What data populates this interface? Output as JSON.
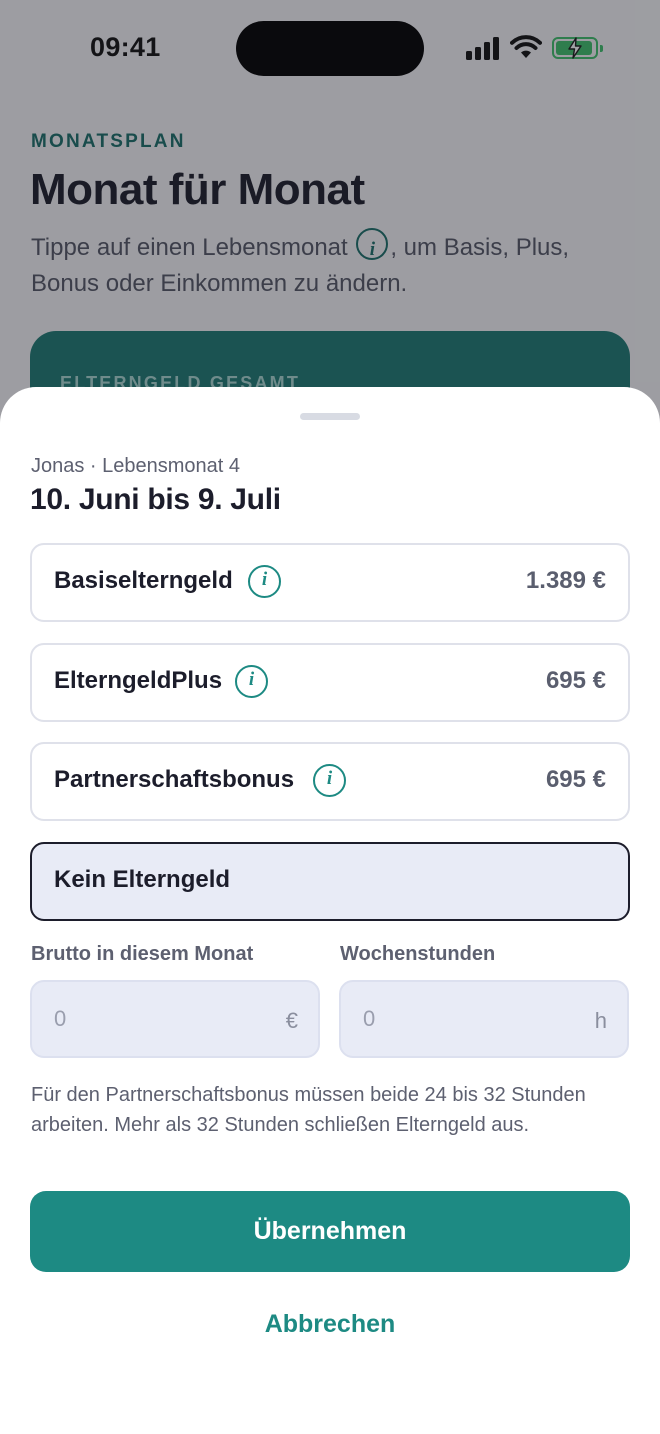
{
  "status_bar": {
    "time": "09:41"
  },
  "background_page": {
    "kicker": "MONATSPLAN",
    "title": "Monat für Monat",
    "subtitle_before_icon": "Tippe auf einen Lebensmonat ",
    "subtitle_after_icon": ", um Basis, Plus, Bonus oder Einkommen zu ändern.",
    "summary_card_label": "ELTERNGELD GESAMT"
  },
  "sheet": {
    "kicker": "Jonas · Lebensmonat 4",
    "title": "10. Juni bis 9. Juli",
    "options": [
      {
        "label": "Basiselterngeld",
        "amount": "1.389 €",
        "icon": "info-icon",
        "selected": false
      },
      {
        "label": "ElterngeldPlus",
        "amount": "695 €",
        "icon": "info-icon",
        "selected": false
      },
      {
        "label": "Partnerschaftsbonus",
        "amount": "695 €",
        "icon": "info-icon",
        "selected": false
      },
      {
        "label": "Kein Elterngeld",
        "amount": "",
        "selected": true
      }
    ],
    "income": {
      "label": "Brutto in diesem Monat",
      "placeholder": "0",
      "value": "",
      "unit": "€"
    },
    "hours": {
      "label": "Wochenstunden",
      "placeholder": "0",
      "value": "",
      "unit": "h"
    },
    "hint": "Für den Partnerschaftsbonus müssen beide 24 bis 32 Stunden arbeiten. Mehr als 32 Stunden schließen Elterngeld aus.",
    "primary_button": "Übernehmen",
    "secondary_button": "Abbrechen"
  },
  "colors": {
    "accent": "#1d8a83",
    "accent_dark": "#1a6f69",
    "text_primary": "#1c1d2b",
    "text_secondary": "#5d6070",
    "selected_bg": "#e8ebf6",
    "battery": "#3ec06c"
  }
}
